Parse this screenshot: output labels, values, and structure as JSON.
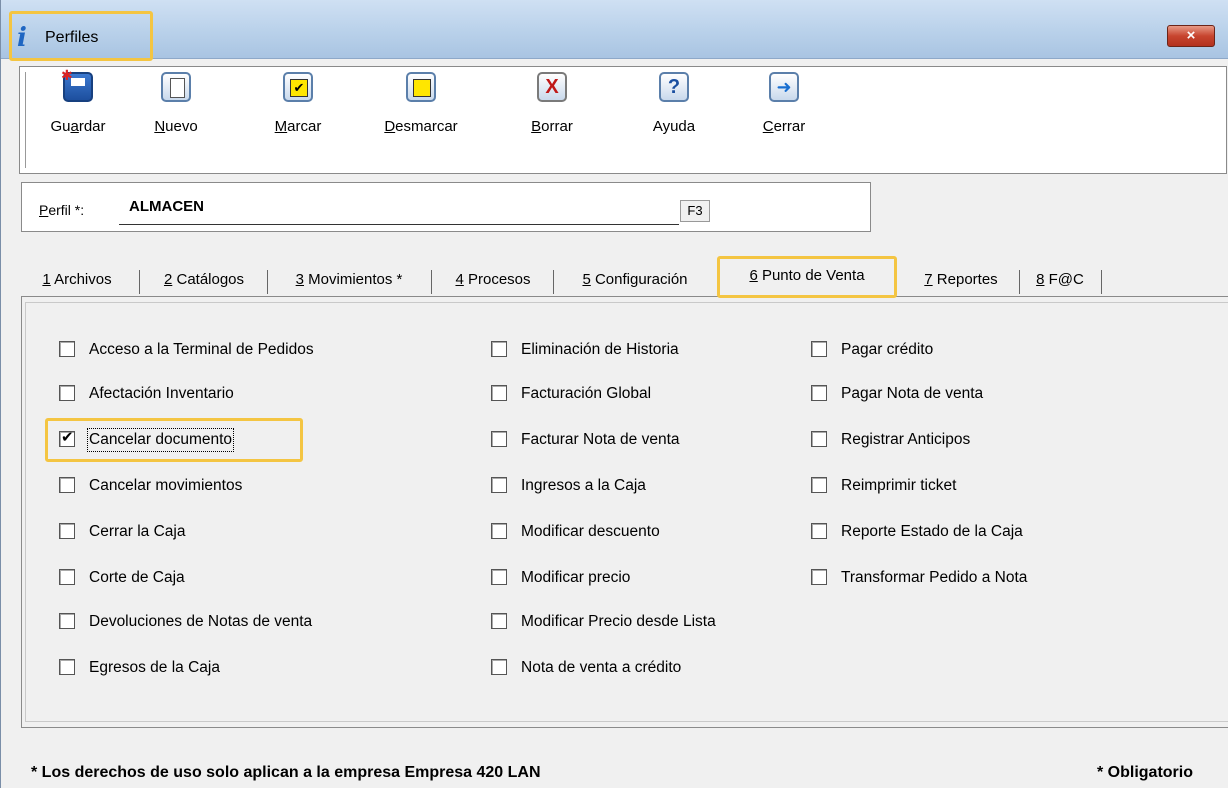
{
  "window": {
    "title": "Perfiles",
    "close_label": "×"
  },
  "toolbar": {
    "buttons": [
      {
        "label_pre": "Gu",
        "label_ul": "a",
        "label_post": "rdar",
        "icon": "save-icon"
      },
      {
        "label_pre": "",
        "label_ul": "N",
        "label_post": "uevo",
        "icon": "new-document-icon"
      },
      {
        "label_pre": "",
        "label_ul": "M",
        "label_post": "arcar",
        "icon": "check-mark-icon"
      },
      {
        "label_pre": "",
        "label_ul": "D",
        "label_post": "esmarcar",
        "icon": "uncheck-icon"
      },
      {
        "label_pre": "",
        "label_ul": "B",
        "label_post": "orrar",
        "icon": "delete-x-icon"
      },
      {
        "label_pre": "Ayuda",
        "label_ul": "",
        "label_post": "",
        "icon": "help-question-icon"
      },
      {
        "label_pre": "",
        "label_ul": "C",
        "label_post": "errar",
        "icon": "exit-door-icon"
      }
    ]
  },
  "perfil": {
    "label_ul": "P",
    "label_rest": "erfil *:",
    "value": "ALMACEN",
    "lookup_key": "F3"
  },
  "tabs": [
    {
      "num": "1",
      "label": " Archivos"
    },
    {
      "num": "2",
      "label": " Catálogos"
    },
    {
      "num": "3",
      "label": " Movimientos *"
    },
    {
      "num": "4",
      "label": " Procesos"
    },
    {
      "num": "5",
      "label": " Configuración"
    },
    {
      "num": "6",
      "label": " Punto de Venta"
    },
    {
      "num": "7",
      "label": " Reportes"
    },
    {
      "num": "8",
      "label": " F@C"
    }
  ],
  "options": {
    "col1": [
      {
        "label": "Acceso a la Terminal de Pedidos",
        "checked": false
      },
      {
        "label": "Afectación Inventario",
        "checked": false
      },
      {
        "label": "Cancelar documento",
        "checked": true
      },
      {
        "label": "Cancelar movimientos",
        "checked": false
      },
      {
        "label": "Cerrar la Caja",
        "checked": false
      },
      {
        "label": "Corte de Caja",
        "checked": false
      },
      {
        "label": "Devoluciones de Notas de venta",
        "checked": false
      },
      {
        "label": "Egresos de la Caja",
        "checked": false
      }
    ],
    "col2": [
      {
        "label": "Eliminación de Historia",
        "checked": false
      },
      {
        "label": "Facturación Global",
        "checked": false
      },
      {
        "label": "Facturar Nota de venta",
        "checked": false
      },
      {
        "label": "Ingresos a la Caja",
        "checked": false
      },
      {
        "label": "Modificar descuento",
        "checked": false
      },
      {
        "label": "Modificar precio",
        "checked": false
      },
      {
        "label": "Modificar Precio desde Lista",
        "checked": false
      },
      {
        "label": "Nota de venta a crédito",
        "checked": false
      }
    ],
    "col3": [
      {
        "label": "Pagar crédito",
        "checked": false
      },
      {
        "label": "Pagar Nota de venta",
        "checked": false
      },
      {
        "label": "Registrar Anticipos",
        "checked": false
      },
      {
        "label": "Reimprimir ticket",
        "checked": false
      },
      {
        "label": "Reporte Estado de la Caja",
        "checked": false
      },
      {
        "label": "Transformar Pedido a Nota",
        "checked": false
      }
    ]
  },
  "footer": {
    "rights_note": "* Los derechos de uso solo aplican a la empresa Empresa 420 LAN",
    "required_note": "* Obligatorio"
  },
  "colors": {
    "highlight": "#f4c542",
    "titlebar": "#b9d1ea",
    "close": "#c7452f"
  }
}
